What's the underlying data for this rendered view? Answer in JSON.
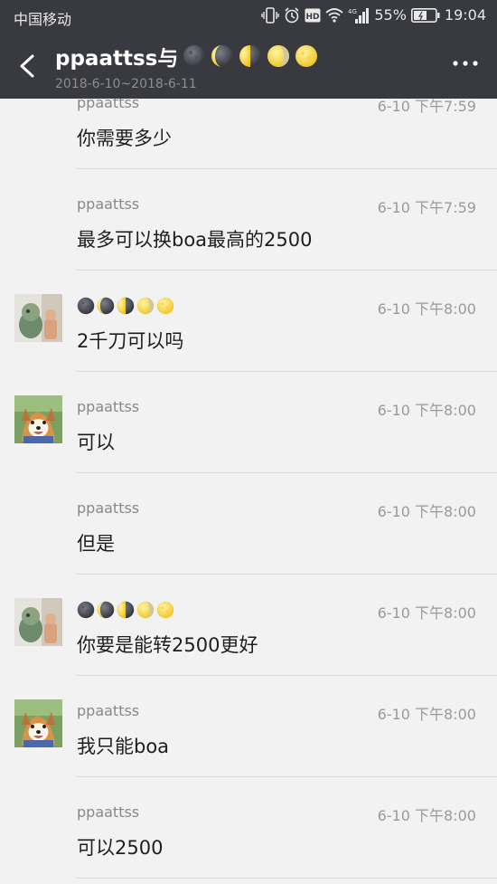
{
  "status": {
    "carrier": "中国移动",
    "battery_pct": "55%",
    "time": "19:04"
  },
  "header": {
    "title": "ppaattss与",
    "date_range": "2018-6-10~2018-6-11"
  },
  "messages": [
    {
      "sender": "ppaattss",
      "time": "6-10 下午7:59",
      "text": "你需要多少",
      "avatar": "none"
    },
    {
      "sender": "ppaattss",
      "time": "6-10 下午7:59",
      "text": "最多可以换boa最高的2500",
      "avatar": "none"
    },
    {
      "sender": "",
      "time": "6-10 下午8:00",
      "text": "2千刀可以吗",
      "avatar": "figurine-avatar"
    },
    {
      "sender": "ppaattss",
      "time": "6-10 下午8:00",
      "text": "可以",
      "avatar": "shiba-avatar"
    },
    {
      "sender": "ppaattss",
      "time": "6-10 下午8:00",
      "text": "但是",
      "avatar": "none"
    },
    {
      "sender": "",
      "time": "6-10 下午8:00",
      "text": "你要是能转2500更好",
      "avatar": "figurine-avatar"
    },
    {
      "sender": "ppaattss",
      "time": "6-10 下午8:00",
      "text": "我只能boa",
      "avatar": "shiba-avatar"
    },
    {
      "sender": "ppaattss",
      "time": "6-10 下午8:00",
      "text": "可以2500",
      "avatar": "none"
    }
  ],
  "colors": {
    "header_bg": "#393a3f",
    "page_bg": "#f2f2f2"
  }
}
